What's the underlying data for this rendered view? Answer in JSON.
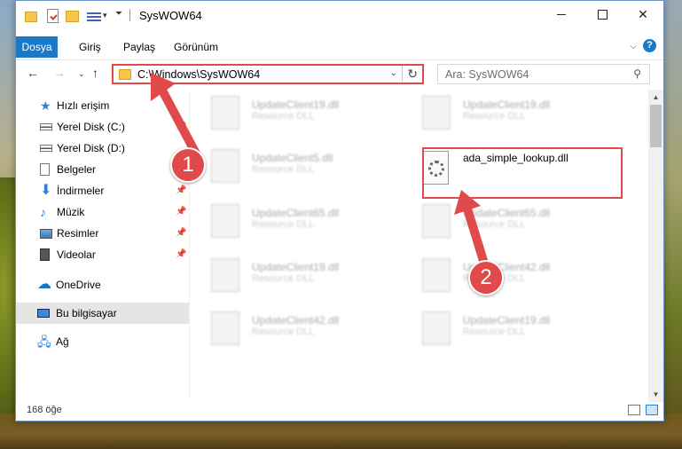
{
  "window": {
    "title": "SysWOW64",
    "close_glyph": "✕"
  },
  "ribbon": {
    "tabs": [
      "Dosya",
      "Giriş",
      "Paylaş",
      "Görünüm"
    ],
    "collapse_glyph": "⌵",
    "help_glyph": "?"
  },
  "nav": {
    "address": "C:\\Windows\\SysWOW64",
    "search_placeholder": "Ara: SysWOW64",
    "back_glyph": "←",
    "forward_glyph": "→",
    "recent_glyph": "⌄",
    "up_glyph": "↑",
    "refresh_glyph": "↻",
    "dropdown_glyph": "⌄",
    "search_glyph": "⚲"
  },
  "sidebar": {
    "items": [
      {
        "label": "Hızlı erişim",
        "icon": "star-icon"
      },
      {
        "label": "Yerel Disk (C:)",
        "icon": "disk-icon",
        "pinned": true
      },
      {
        "label": "Yerel Disk (D:)",
        "icon": "disk-icon"
      },
      {
        "label": "Belgeler",
        "icon": "documents-icon"
      },
      {
        "label": "İndirmeler",
        "icon": "download-icon",
        "pinned": true
      },
      {
        "label": "Müzik",
        "icon": "music-icon",
        "pinned": true
      },
      {
        "label": "Resimler",
        "icon": "pictures-icon",
        "pinned": true
      },
      {
        "label": "Videolar",
        "icon": "videos-icon",
        "pinned": true
      },
      {
        "label": "OneDrive",
        "icon": "onedrive-icon"
      },
      {
        "label": "Bu bilgisayar",
        "icon": "computer-icon",
        "selected": true
      },
      {
        "label": "Ağ",
        "icon": "network-icon"
      }
    ],
    "pin_glyph": "📌"
  },
  "files": {
    "left": [
      {
        "name": "UpdateClient19.dll",
        "desc": "Resource DLL"
      },
      {
        "name": "UpdateClient5.dll",
        "desc": "Resource DLL"
      },
      {
        "name": "UpdateClient65.dll",
        "desc": "Resource DLL"
      },
      {
        "name": "UpdateClient19.dll",
        "desc": "Resource DLL"
      },
      {
        "name": "UpdateClient42.dll",
        "desc": "Resource DLL"
      }
    ],
    "right": [
      {
        "name": "UpdateClient19.dll",
        "desc": "Resource DLL"
      },
      {
        "name": "ada_simple_lookup.dll",
        "desc": ""
      },
      {
        "name": "UpdateClient65.dll",
        "desc": "Resource DLL"
      },
      {
        "name": "UpdateClient42.dll",
        "desc": "Resource DLL"
      },
      {
        "name": "UpdateClient19.dll",
        "desc": "Resource DLL"
      }
    ]
  },
  "status": {
    "item_count": "168 öğe"
  },
  "annotations": {
    "step1": "1",
    "step2": "2",
    "color": "#e04a4a"
  },
  "colors": {
    "accent": "#1979ca",
    "highlight": "#e04a4a"
  }
}
